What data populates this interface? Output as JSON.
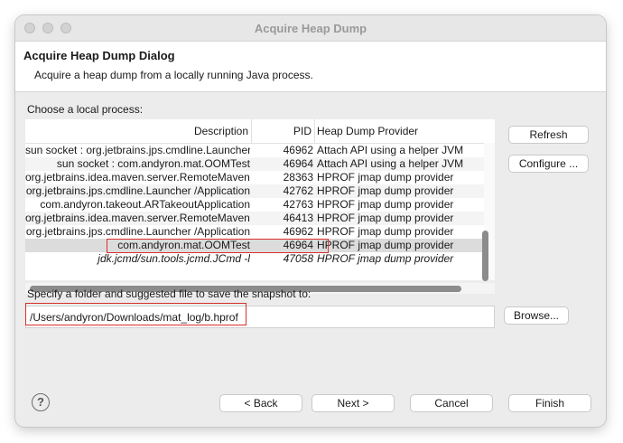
{
  "window": {
    "title": "Acquire Heap Dump"
  },
  "header": {
    "title": "Acquire Heap Dump Dialog",
    "description": "Acquire a heap dump from a locally running Java process."
  },
  "process_section": {
    "label": "Choose a local process:",
    "columns": [
      "Description",
      "PID",
      "Heap Dump Provider"
    ],
    "rows": [
      {
        "description": "sun socket : org.jetbrains.jps.cmdline.Launcher",
        "pid": "46962",
        "provider": "Attach API using a helper JVM"
      },
      {
        "description": "sun socket : com.andyron.mat.OOMTest",
        "pid": "46964",
        "provider": "Attach API using a helper JVM"
      },
      {
        "description": "org.jetbrains.idea.maven.server.RemoteMavenS",
        "pid": "28363",
        "provider": "HPROF jmap dump provider"
      },
      {
        "description": "org.jetbrains.jps.cmdline.Launcher /Application",
        "pid": "42762",
        "provider": "HPROF jmap dump provider"
      },
      {
        "description": "com.andyron.takeout.ARTakeoutApplication",
        "pid": "42763",
        "provider": "HPROF jmap dump provider"
      },
      {
        "description": "org.jetbrains.idea.maven.server.RemoteMavenS",
        "pid": "46413",
        "provider": "HPROF jmap dump provider"
      },
      {
        "description": "org.jetbrains.jps.cmdline.Launcher /Application",
        "pid": "46962",
        "provider": "HPROF jmap dump provider"
      },
      {
        "description": "com.andyron.mat.OOMTest",
        "pid": "46964",
        "provider": "HPROF jmap dump provider"
      },
      {
        "description": "jdk.jcmd/sun.tools.jcmd.JCmd -l",
        "pid": "47058",
        "provider": "HPROF jmap dump provider"
      }
    ],
    "selected_row": 7,
    "buttons": {
      "refresh": "Refresh",
      "configure": "Configure ..."
    }
  },
  "snapshot_section": {
    "label": "Specify a folder and suggested file to save the snapshot to:",
    "path_value": "/Users/andyron/Downloads/mat_log/b.hprof",
    "browse": "Browse..."
  },
  "footer": {
    "help_icon": "?",
    "back": "< Back",
    "next": "Next >",
    "cancel": "Cancel",
    "finish": "Finish"
  },
  "colors": {
    "highlight_border": "#d9302f",
    "selected_row": "#dcdcdc"
  }
}
